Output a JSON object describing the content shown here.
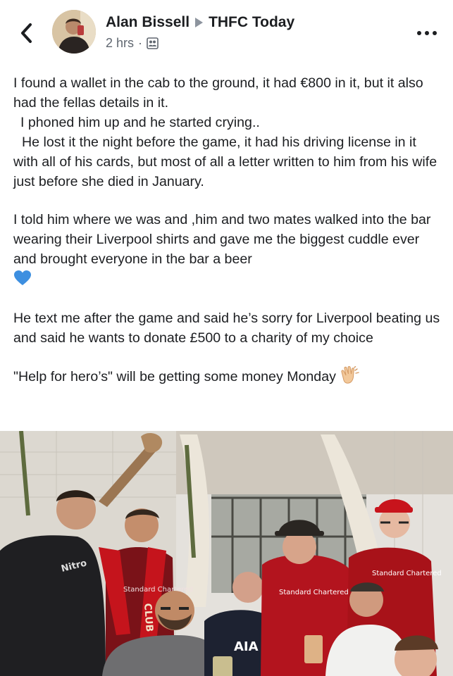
{
  "header": {
    "author": "Alan Bissell",
    "group": "THFC Today",
    "time": "2 hrs",
    "separator": "·"
  },
  "post": {
    "paragraphs": [
      "I found a wallet in the cab to the ground, it had €800 in it, but it also had the fellas details in it.",
      "I phoned him up and he started crying..",
      "He lost it the night before the game, it had his driving license in it with all of his cards, but most of all a letter written to him from his wife just before she died in January.",
      "I told him where we was and ,him and two mates walked into the bar wearing their Liverpool shirts and gave me the biggest cuddle ever and brought everyone in the bar a beer",
      "He text me after the game and said he’s sorry for Liverpool beating us and said he wants to donate £500 to a charity of my choice",
      "\"Help for hero’s\" will be getting some money Monday"
    ]
  },
  "photo": {
    "sign_text": "CLUB",
    "shirt_logo_1": "Standard Chartered",
    "shirt_logo_2": "Standard Chartered",
    "shirt_logo_3": "Standard Chartered",
    "shirt_sponsor": "AIA",
    "tshirt_text": "Nitro"
  },
  "colors": {
    "text": "#1c1e21",
    "secondary": "#606770",
    "liverpool_red": "#b3141e",
    "heart_blue": "#3d8fe0"
  },
  "icons": [
    "back-chevron-icon",
    "privacy-group-icon",
    "more-dots-icon",
    "blue-heart-icon",
    "clapping-hands-icon"
  ]
}
